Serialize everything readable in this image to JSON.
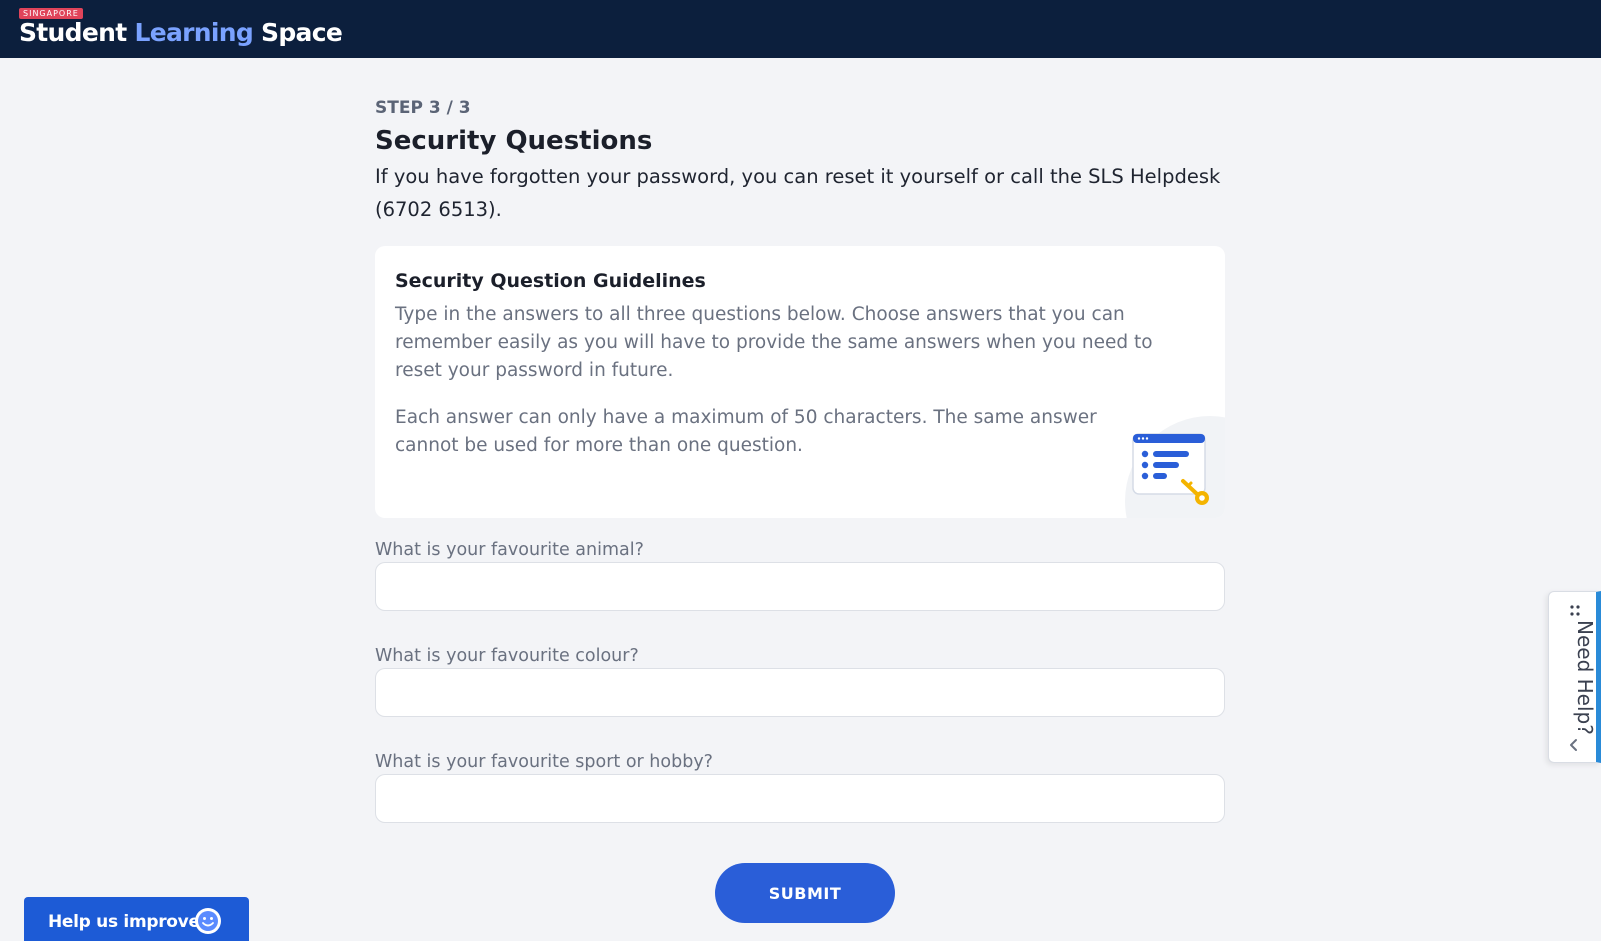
{
  "header": {
    "brand_tag": "SINGAPORE",
    "brand_word1": "Student",
    "brand_word2": "Learning",
    "brand_word3": "Space"
  },
  "page": {
    "step": "STEP 3 / 3",
    "title": "Security Questions",
    "intro": "If you have forgotten your password, you can reset it yourself or call the SLS Helpdesk (6702 6513)."
  },
  "guidelines": {
    "title": "Security Question Guidelines",
    "paragraph1": "Type in the answers to all three questions below. Choose answers that you can remember easily as you will have to provide the same answers when you need to reset your password in future.",
    "paragraph2": "Each answer can only have a maximum of 50 characters. The same answer cannot be used for more than one question.",
    "illustration_icon": "security-list-key-icon"
  },
  "questions": [
    {
      "label": "What is your favourite animal?",
      "value": "",
      "placeholder": ""
    },
    {
      "label": "What is your favourite colour?",
      "value": "",
      "placeholder": ""
    },
    {
      "label": "What is your favourite sport or hobby?",
      "value": "",
      "placeholder": ""
    }
  ],
  "actions": {
    "submit_label": "SUBMIT"
  },
  "help_tab": {
    "label": "Need Help?",
    "icon": "drag-dots-icon",
    "chevron_icon": "chevron-left-icon"
  },
  "feedback": {
    "label": "Help us improve",
    "icon": "smiley-icon"
  },
  "colors": {
    "header_bg": "#0c1f3d",
    "accent": "#2a5ed8",
    "brand_tag": "#e0445a",
    "brand_accent_text": "#7aa2ff"
  }
}
